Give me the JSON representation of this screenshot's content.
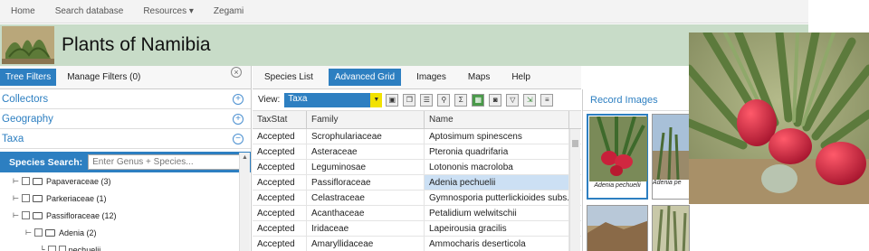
{
  "topnav": {
    "items": [
      "Home",
      "Search database",
      "Resources ▾",
      "Zegami"
    ]
  },
  "banner": {
    "title": "Plants of Namibia"
  },
  "left": {
    "tabs": [
      "Tree Filters",
      "Manage Filters (0)"
    ],
    "sections": [
      "Collectors",
      "Geography",
      "Taxa"
    ],
    "search_label": "Species Search:",
    "search_placeholder": "Enter Genus + Species...",
    "tree": [
      "Papaveraceae (3)",
      "Parkeriaceae (1)",
      "Passifloraceae (12)",
      "Adenia (2)",
      "pechuelii"
    ]
  },
  "mid": {
    "tabs": [
      "Species List",
      "Advanced Grid",
      "Images",
      "Maps",
      "Help"
    ],
    "view_label": "View:",
    "view_value": "Taxa",
    "columns": [
      "TaxStat",
      "Family",
      "Name"
    ],
    "rows": [
      [
        "Accepted",
        "Scrophulariaceae",
        "Aptosimum spinescens"
      ],
      [
        "Accepted",
        "Asteraceae",
        "Pteronia quadrifaria"
      ],
      [
        "Accepted",
        "Leguminosae",
        "Lotononis macroloba"
      ],
      [
        "Accepted",
        "Passifloraceae",
        "Adenia pechuelii"
      ],
      [
        "Accepted",
        "Celastraceae",
        "Gymnosporia putterlickioides subs..."
      ],
      [
        "Accepted",
        "Acanthaceae",
        "Petalidium welwitschii"
      ],
      [
        "Accepted",
        "Iridaceae",
        "Lapeirousia gracilis"
      ],
      [
        "Accepted",
        "Amaryllidaceae",
        "Ammocharis deserticola"
      ]
    ]
  },
  "right": {
    "title": "Record Images",
    "captions": [
      "Adenia pechuelii",
      "Adenia pe"
    ]
  },
  "colors": {
    "accent": "#2d7fc1",
    "banner": "#c8dcc8",
    "selected_row": "#cce0f4"
  }
}
